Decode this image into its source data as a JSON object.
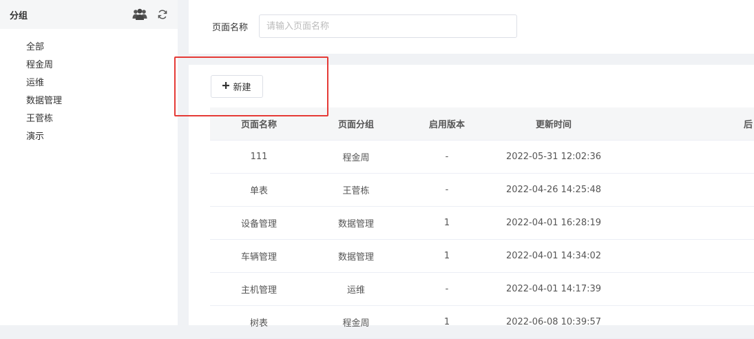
{
  "sidebar": {
    "title": "分组",
    "icons": [
      "users-icon",
      "refresh-icon"
    ],
    "groups": [
      "全部",
      "程金周",
      "运维",
      "数据管理",
      "王菅栋",
      "演示"
    ]
  },
  "search": {
    "label": "页面名称",
    "placeholder": "请输入页面名称",
    "value": ""
  },
  "toolbar": {
    "new_label": "新建",
    "new_icon": "plus-icon"
  },
  "table": {
    "headers": [
      "页面名称",
      "页面分组",
      "启用版本",
      "更新时间",
      "后"
    ],
    "rows": [
      [
        "111",
        "程金周",
        "-",
        "2022-05-31 12:02:36"
      ],
      [
        "单表",
        "王菅栋",
        "-",
        "2022-04-26 14:25:48"
      ],
      [
        "设备管理",
        "数据管理",
        "1",
        "2022-04-01 16:28:19"
      ],
      [
        "车辆管理",
        "数据管理",
        "1",
        "2022-04-01 14:34:02"
      ],
      [
        "主机管理",
        "运维",
        "-",
        "2022-04-01 14:17:39"
      ],
      [
        "树表",
        "程金周",
        "1",
        "2022-06-08 10:39:57"
      ]
    ]
  },
  "colors": {
    "highlight": "#e53935",
    "header_bg": "#f5f6f7",
    "page_bg": "#f0f2f5"
  }
}
